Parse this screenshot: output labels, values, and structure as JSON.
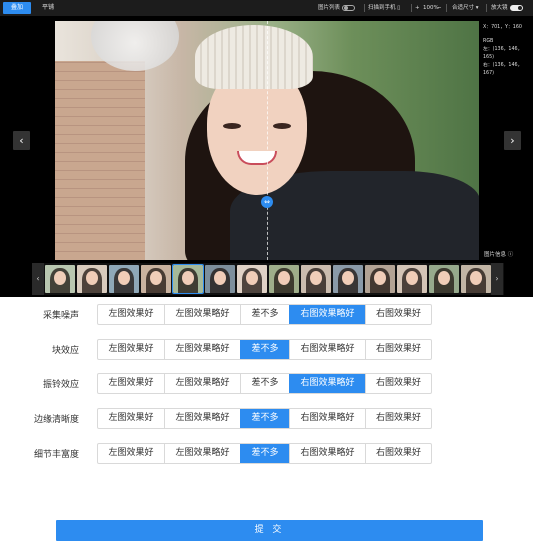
{
  "viewer": {
    "mode_tabs": [
      "叠加",
      "平铺"
    ],
    "active_mode": "叠加",
    "toolbar": {
      "image_list": "图片列表",
      "scan_phone": "扫描到手机",
      "zoom_in": "+",
      "zoom_level": "100%",
      "zoom_out": "−",
      "fit_size": "合适尺寸",
      "magnifier": "放大镜"
    },
    "info": {
      "coords": "X：701，Y：160",
      "rgb_title": "RGB",
      "rgb_left": "左：(136，146，165)",
      "rgb_right": "右：(136，146，167)"
    },
    "photo_info_label": "图片信息",
    "thumbnail_count": 14,
    "active_thumbnail": 5,
    "icons": {
      "prev": "chevron-left-icon",
      "next": "chevron-right-icon",
      "split_handle": "split-drag-icon",
      "info": "info-icon"
    },
    "accent_color": "#2d8cf0"
  },
  "options": [
    "左图效果好",
    "左图效果略好",
    "差不多",
    "右图效果略好",
    "右图效果好"
  ],
  "criteria": [
    {
      "label": "采集噪声",
      "selected": "右图效果略好"
    },
    {
      "label": "块效应",
      "selected": "差不多"
    },
    {
      "label": "振铃效应",
      "selected": "右图效果略好"
    },
    {
      "label": "边缘清晰度",
      "selected": "差不多"
    },
    {
      "label": "细节丰富度",
      "selected": "差不多"
    }
  ],
  "submit_label": "提 交"
}
